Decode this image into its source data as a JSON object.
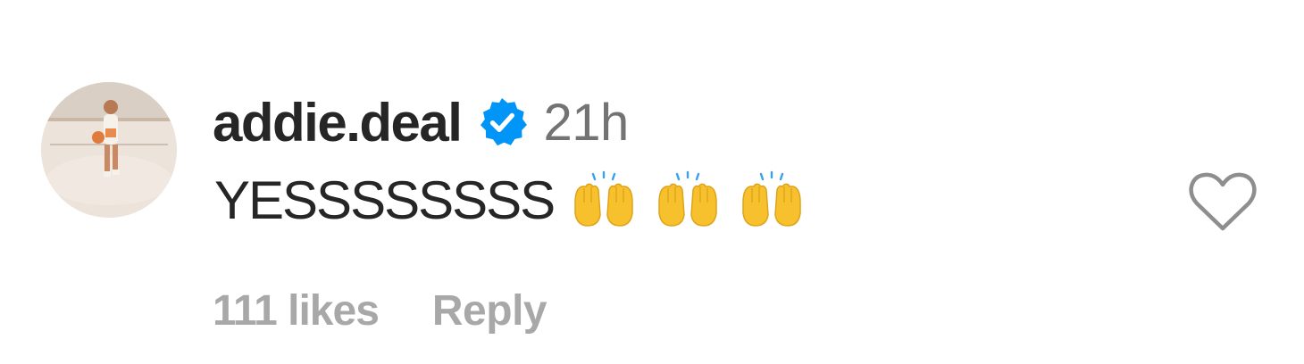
{
  "comment": {
    "avatar_icon": "profile-photo-basketball-player",
    "username": "addie.deal",
    "verified_icon": "verified-badge-icon",
    "timestamp": "21h",
    "text": "YESSSSSSSS",
    "emojis": [
      "raising-hands",
      "raising-hands",
      "raising-hands"
    ],
    "like_icon": "heart-outline-icon",
    "likes_label": "111 likes",
    "reply_label": "Reply"
  },
  "colors": {
    "primary_text": "#262626",
    "secondary_text": "#737373",
    "tertiary_text": "#a8a8a8",
    "verified_blue": "#0095f6",
    "emoji_yellow": "#f7c12e"
  }
}
